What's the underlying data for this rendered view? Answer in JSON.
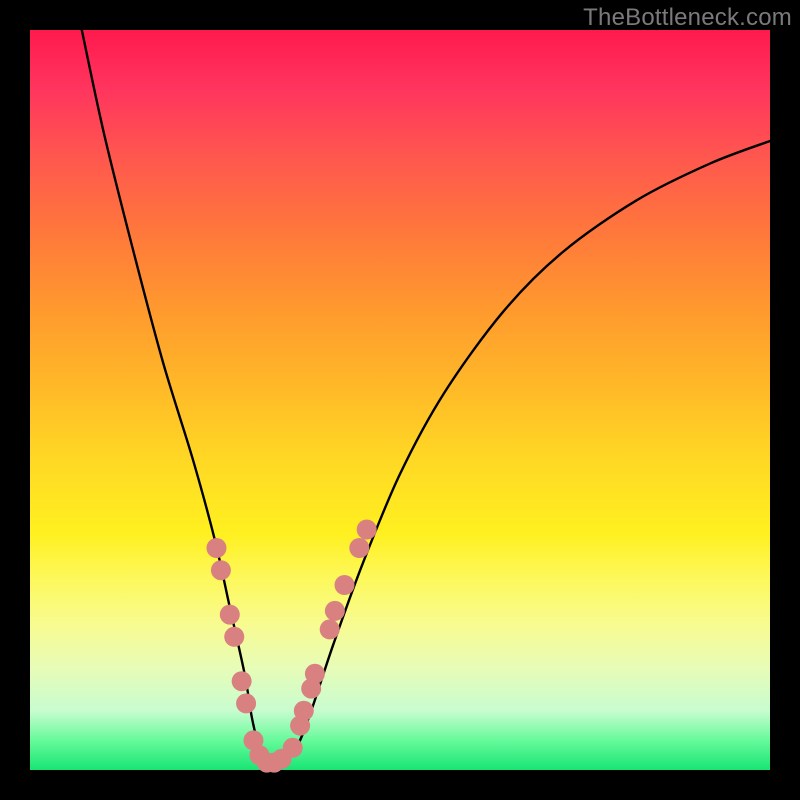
{
  "watermark": "TheBottleneck.com",
  "chart_data": {
    "type": "line",
    "title": "",
    "xlabel": "",
    "ylabel": "",
    "xlim": [
      0,
      100
    ],
    "ylim": [
      0,
      100
    ],
    "grid": false,
    "series": [
      {
        "name": "bottleneck-curve",
        "x": [
          7,
          10,
          14,
          18,
          22,
          25,
          27,
          29,
          30,
          31,
          32,
          33,
          34,
          36,
          38,
          41,
          45,
          50,
          56,
          64,
          72,
          82,
          92,
          100
        ],
        "y": [
          100,
          86,
          70,
          55,
          42,
          31,
          22,
          13,
          7,
          3,
          1,
          0,
          1,
          3,
          8,
          17,
          28,
          40,
          51,
          62,
          70,
          77,
          82,
          85
        ]
      }
    ],
    "markers": {
      "name": "bead-markers",
      "color": "#d98181",
      "radius_px": 10,
      "points": [
        {
          "x": 25.2,
          "y": 30
        },
        {
          "x": 25.8,
          "y": 27
        },
        {
          "x": 27.0,
          "y": 21
        },
        {
          "x": 27.6,
          "y": 18
        },
        {
          "x": 28.6,
          "y": 12
        },
        {
          "x": 29.2,
          "y": 9
        },
        {
          "x": 30.2,
          "y": 4
        },
        {
          "x": 31.0,
          "y": 2
        },
        {
          "x": 32.0,
          "y": 1
        },
        {
          "x": 33.0,
          "y": 1
        },
        {
          "x": 34.0,
          "y": 1.5
        },
        {
          "x": 35.5,
          "y": 3
        },
        {
          "x": 36.5,
          "y": 6
        },
        {
          "x": 37.0,
          "y": 8
        },
        {
          "x": 38.0,
          "y": 11
        },
        {
          "x": 38.5,
          "y": 13
        },
        {
          "x": 40.5,
          "y": 19
        },
        {
          "x": 41.2,
          "y": 21.5
        },
        {
          "x": 42.5,
          "y": 25
        },
        {
          "x": 44.5,
          "y": 30
        },
        {
          "x": 45.5,
          "y": 32.5
        }
      ]
    }
  }
}
